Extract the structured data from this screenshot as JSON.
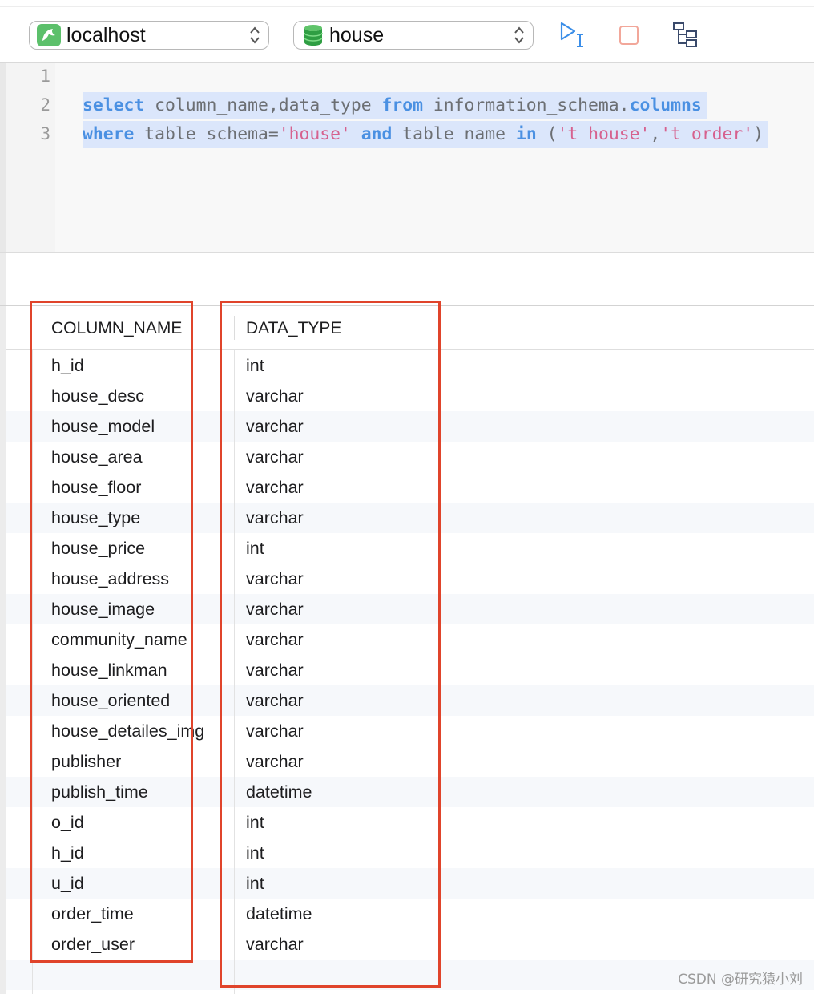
{
  "toolbar": {
    "connection": {
      "label": "localhost",
      "icon": "mysql-dolphin-icon"
    },
    "database": {
      "label": "house",
      "icon": "database-icon"
    },
    "buttons": [
      {
        "name": "run-button",
        "icon": "run-current-icon",
        "color": "#3b8ee8"
      },
      {
        "name": "stop-button",
        "icon": "stop-icon",
        "color": "#f2a79a"
      },
      {
        "name": "explain-button",
        "icon": "explain-tree-icon",
        "color": "#3a4a6b"
      }
    ]
  },
  "editor": {
    "line_numbers": [
      "1",
      "2",
      "3"
    ],
    "lines": [
      [],
      [
        {
          "t": "select",
          "k": "kw"
        },
        {
          "t": " column_name,data_type ",
          "k": "id"
        },
        {
          "t": "from",
          "k": "kw"
        },
        {
          "t": " information_schema.",
          "k": "id"
        },
        {
          "t": "columns",
          "k": "kw"
        }
      ],
      [
        {
          "t": "where",
          "k": "kw"
        },
        {
          "t": " table_schema=",
          "k": "id"
        },
        {
          "t": "'house'",
          "k": "str"
        },
        {
          "t": " ",
          "k": "id"
        },
        {
          "t": "and",
          "k": "kw"
        },
        {
          "t": " table_name ",
          "k": "id"
        },
        {
          "t": "in",
          "k": "kw"
        },
        {
          "t": " (",
          "k": "id"
        },
        {
          "t": "'t_house'",
          "k": "str"
        },
        {
          "t": ",",
          "k": "id"
        },
        {
          "t": "'t_order'",
          "k": "str"
        },
        {
          "t": ")",
          "k": "id"
        }
      ]
    ]
  },
  "results": {
    "columns": [
      "COLUMN_NAME",
      "DATA_TYPE"
    ],
    "rows": [
      [
        "h_id",
        "int"
      ],
      [
        "house_desc",
        "varchar"
      ],
      [
        "house_model",
        "varchar"
      ],
      [
        "house_area",
        "varchar"
      ],
      [
        "house_floor",
        "varchar"
      ],
      [
        "house_type",
        "varchar"
      ],
      [
        "house_price",
        "int"
      ],
      [
        "house_address",
        "varchar"
      ],
      [
        "house_image",
        "varchar"
      ],
      [
        "community_name",
        "varchar"
      ],
      [
        "house_linkman",
        "varchar"
      ],
      [
        "house_oriented",
        "varchar"
      ],
      [
        "house_detailes_img",
        "varchar"
      ],
      [
        "publisher",
        "varchar"
      ],
      [
        "publish_time",
        "datetime"
      ],
      [
        "o_id",
        "int"
      ],
      [
        "h_id",
        "int"
      ],
      [
        "u_id",
        "int"
      ],
      [
        "order_time",
        "datetime"
      ],
      [
        "order_user",
        "varchar"
      ]
    ]
  },
  "annotation_color": "#e0442b",
  "watermark": "CSDN @研究猿小刘"
}
